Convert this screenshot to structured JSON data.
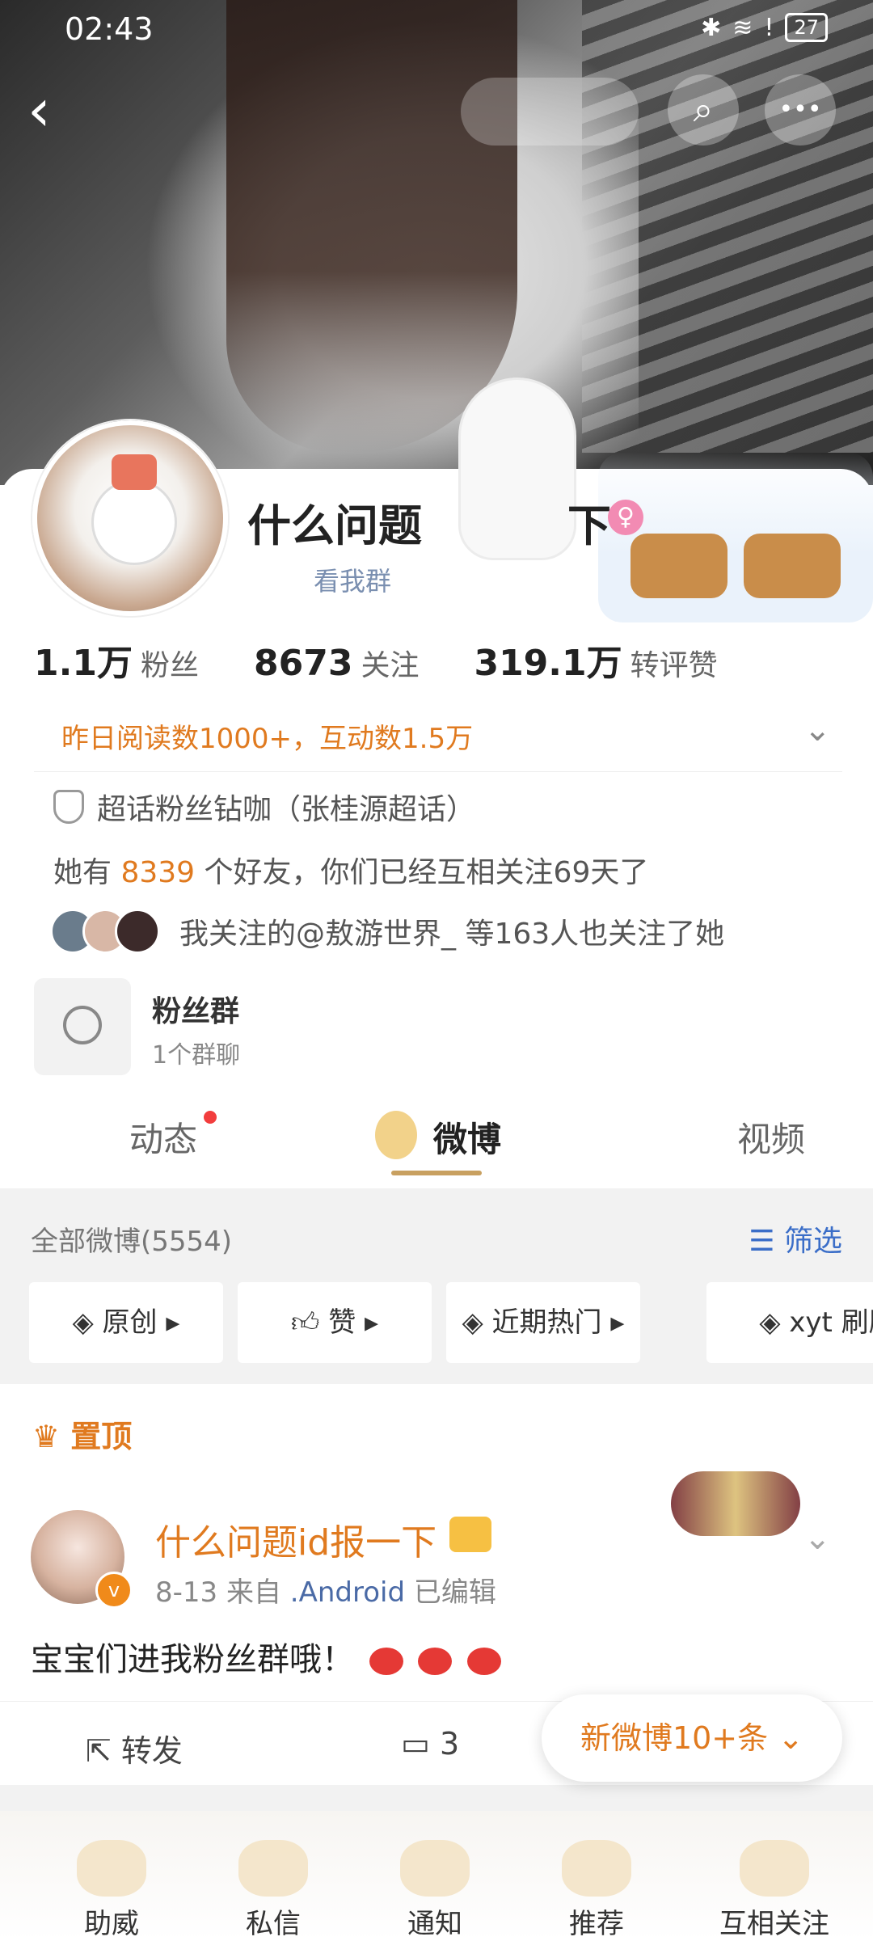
{
  "status_bar": {
    "time": "02:43",
    "battery": "27"
  },
  "nav": {
    "back": "‹",
    "search": "⌕",
    "more": "•••"
  },
  "profile": {
    "name": "什么问题",
    "name_tail": "下",
    "sub_link": "看我群",
    "stats": [
      {
        "value": "1.1万",
        "label": "粉丝"
      },
      {
        "value": "8673",
        "label": "关注"
      },
      {
        "value": "319.1万",
        "label": "转评赞"
      }
    ],
    "read_stats": "昨日阅读数1000+，互动数1.5万",
    "super_topic": "超话粉丝钻咖（张桂源超话）",
    "friends_prefix": "她有",
    "friends_count": "8339",
    "friends_suffix": "个好友，你们已经互相关注69天了",
    "mutual_text": "我关注的@敖游世界_ 等163人也关注了她",
    "group": {
      "title": "粉丝群",
      "sub": "1个群聊"
    }
  },
  "tabs": [
    {
      "label": "动态",
      "badge": true
    },
    {
      "label": "微博",
      "active": true
    },
    {
      "label": "视频"
    }
  ],
  "feed": {
    "header": "全部微博(5554)",
    "filter": "筛选",
    "chips": [
      "原创",
      "赞",
      "近期热门",
      "xyt 刷刷"
    ],
    "pinned_label": "置顶",
    "post": {
      "author": "什么问题id报一下",
      "date": "8-13",
      "from_prefix": "来自",
      "source": ".Android",
      "edited": "已编辑",
      "text": "宝宝们进我粉丝群哦！",
      "repost_label": "转发",
      "comment_count": "3"
    },
    "new_posts": "新微博10+条 ⌄"
  },
  "bottom_nav": [
    "助威",
    "私信",
    "通知",
    "推荐",
    "互相关注"
  ],
  "colors": {
    "accent_orange": "#e07a1f",
    "link_blue": "#3b6ec8",
    "pink": "#f28bb3"
  }
}
